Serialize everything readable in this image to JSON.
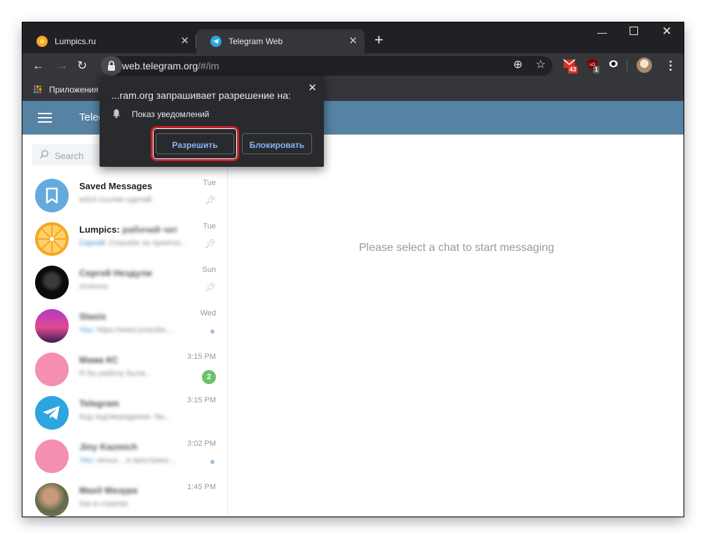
{
  "browser": {
    "tabs": [
      {
        "title": "Lumpics.ru",
        "icon": "orange-icon",
        "active": false
      },
      {
        "title": "Telegram Web",
        "icon": "telegram-icon",
        "active": true
      }
    ],
    "url_host": "web.telegram.org",
    "url_path": "/#/im",
    "extensions": [
      {
        "icon": "mail-extension-icon",
        "badge": "43",
        "badge_color": "#d93025"
      },
      {
        "icon": "ublock-icon",
        "badge": "1",
        "badge_color": "#5f6368"
      },
      {
        "icon": "eye-extension-icon"
      }
    ],
    "bookmarks_apps_label": "Приложения"
  },
  "permission_popup": {
    "title": "...ram.org запрашивает разрешение на:",
    "permission": "Показ уведомлений",
    "allow_label": "Разрешить",
    "block_label": "Блокировать"
  },
  "telegram": {
    "header_title": "Telegram",
    "search_placeholder": "Search",
    "empty_message": "Please select a chat to start messaging",
    "chats": [
      {
        "name": "Saved Messages",
        "preview": "ed14 ссылки сделай",
        "sender": "",
        "time": "Tue",
        "status": "pinned",
        "avatar": "saved",
        "name_blurred": false
      },
      {
        "name": "Lumpics:",
        "name_extra": "рабочий чат",
        "preview": "Спасибо за приятно...",
        "sender": "Сергей:",
        "time": "Tue",
        "status": "pinned",
        "avatar": "lumpics",
        "name_blurred": false
      },
      {
        "name": "Сергей Нездули",
        "preview": "отлично",
        "sender": "",
        "time": "Sun",
        "status": "pinned",
        "avatar": "dark",
        "name_blurred": true
      },
      {
        "name": "Stasis",
        "preview": "https://www.youtube....",
        "sender": "You:",
        "time": "Wed",
        "status": "dot",
        "avatar": "purple",
        "name_blurred": true
      },
      {
        "name": "Мама КС",
        "preview": "Я бы рабочу была...",
        "sender": "",
        "time": "3:15 PM",
        "status": "unread",
        "unread": "2",
        "avatar": "pink",
        "name_blurred": true
      },
      {
        "name": "Telegram",
        "preview": "Код подтверждения. Ne...",
        "sender": "",
        "time": "3:15 PM",
        "status": "none",
        "avatar": "telegram",
        "name_blurred": true
      },
      {
        "name": "Jiny Kazmich",
        "preview": "ничья... а пространс...",
        "sender": "You:",
        "time": "3:02 PM",
        "status": "dot",
        "avatar": "pink",
        "name_blurred": true
      },
      {
        "name": "Maxil Мазура",
        "preview": "Как в стрелки",
        "sender": "",
        "time": "1:45 PM",
        "status": "none",
        "avatar": "photo",
        "name_blurred": true
      }
    ]
  },
  "colors": {
    "telegram_header": "#5682a3",
    "chrome_dark": "#202124",
    "chrome_toolbar": "#35363a",
    "highlight_border": "#c8202a",
    "unread_badge": "#6ec26a"
  }
}
